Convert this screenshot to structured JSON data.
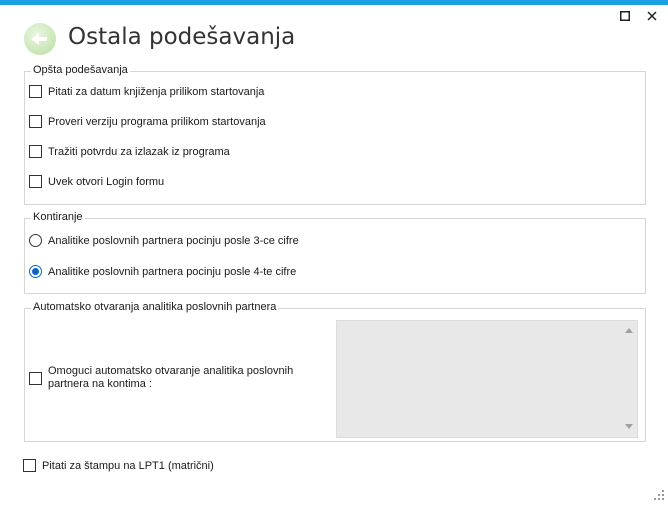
{
  "window": {
    "title": "Ostala podešavanja",
    "accent_color": "#1ba1e2",
    "icons": {
      "back": "back-arrow-icon",
      "maximize": "maximize-icon",
      "close": "close-icon"
    }
  },
  "general_settings": {
    "legend": "Opšta podešavanja",
    "options": [
      {
        "label": "Pitati za datum knjiženja prilikom startovanja",
        "checked": false
      },
      {
        "label": "Proveri verziju programa prilikom startovanja",
        "checked": false
      },
      {
        "label": "Tražiti potvrdu za izlazak iz programa",
        "checked": false
      },
      {
        "label": "Uvek otvori Login formu",
        "checked": false
      }
    ]
  },
  "kontiranje": {
    "legend": "Kontiranje",
    "options": [
      {
        "label": "Analitike poslovnih partnera pocinju posle 3-ce cifre",
        "selected": false
      },
      {
        "label": "Analitike poslovnih partnera pocinju posle 4-te cifre",
        "selected": true
      }
    ],
    "selected_color": "#0a64c8"
  },
  "auto_open": {
    "legend": "Automatsko otvaranja analitika poslovnih partnera",
    "option_line1": "Omoguci automatsko otvaranje analitika poslovnih",
    "option_line2": "partnera na kontima :",
    "checked": false
  },
  "footer": {
    "print_option": "Pitati za štampu na LPT1 (matrični)",
    "checked": false
  }
}
